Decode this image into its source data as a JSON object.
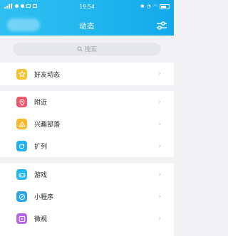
{
  "status": {
    "time": "19:54"
  },
  "header": {
    "title": "动态"
  },
  "search": {
    "placeholder": "搜索"
  },
  "groups": [
    {
      "items": [
        {
          "label": "好友动态",
          "icon": "star-icon",
          "color": "#f6c12a"
        }
      ]
    },
    {
      "items": [
        {
          "label": "附近",
          "icon": "location-pin-icon",
          "color": "#f0556a"
        },
        {
          "label": "兴趣部落",
          "icon": "tent-icon",
          "color": "#f7b929"
        },
        {
          "label": "扩列",
          "icon": "expand-list-icon",
          "color": "#1fb2ee"
        }
      ]
    },
    {
      "items": [
        {
          "label": "游戏",
          "icon": "gamepad-icon",
          "color": "#23b8ef"
        },
        {
          "label": "小程序",
          "icon": "mini-program-icon",
          "color": "#2aa7e6"
        },
        {
          "label": "微视",
          "icon": "video-icon",
          "color": "#b965e8"
        }
      ]
    }
  ],
  "chevron": "›"
}
